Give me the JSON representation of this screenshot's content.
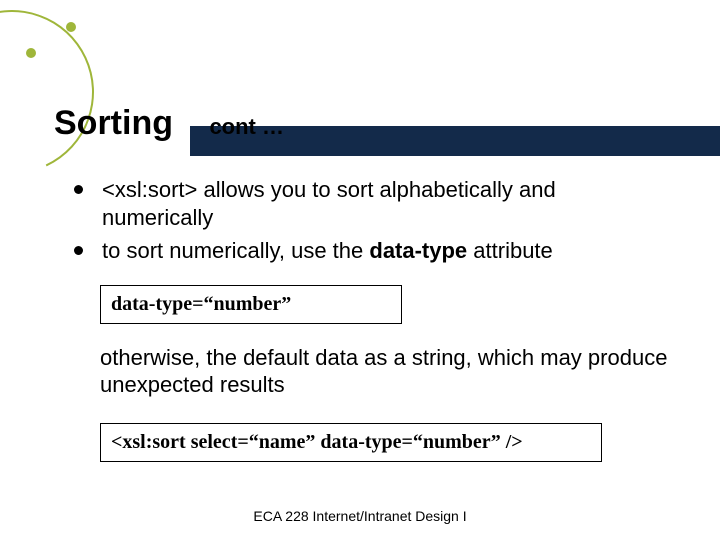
{
  "title": "Sorting",
  "subtitle": "cont …",
  "bullets": [
    {
      "pre": "<xsl:sort> allows you to sort alphabetically and numerically"
    },
    {
      "pre": "to sort numerically, use the ",
      "bold": "data-type",
      "post": " attribute"
    }
  ],
  "code1": "data-type=“number”",
  "paragraph": "otherwise, the default data as a string, which may produce unexpected results",
  "code2": "<xsl:sort select=“name” data-type=“number” />",
  "footer": "ECA 228  Internet/Intranet Design I",
  "colors": {
    "bar": "#132a4a",
    "accent": "#9fb63a"
  }
}
